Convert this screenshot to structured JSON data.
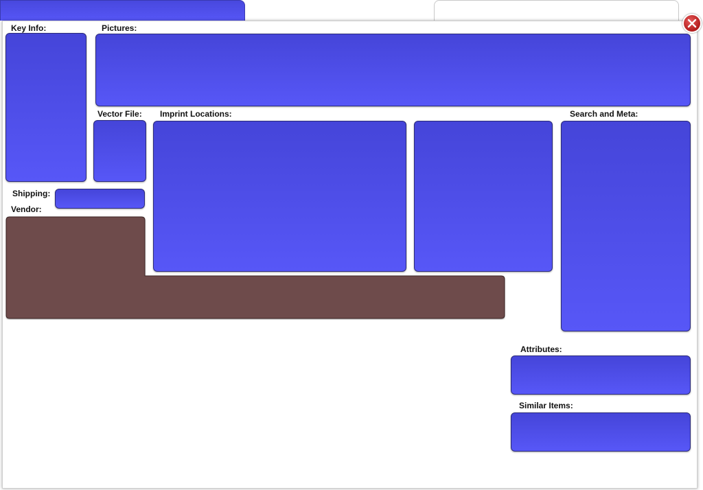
{
  "labels": {
    "key_info": "Key Info:",
    "pictures": "Pictures:",
    "vector_file": "Vector File:",
    "imprint_locations": "Imprint Locations:",
    "search_and_meta": "Search and Meta:",
    "shipping": "Shipping:",
    "vendor": "Vendor:",
    "attributes": "Attributes:",
    "similar_items": "Similar Items:"
  },
  "icons": {
    "close": "close-icon"
  },
  "colors": {
    "box_fill_top": "#4545d9",
    "box_fill_bottom": "#5757f7",
    "vendor_fill": "#6e4b4b",
    "close_red": "#b31c1c"
  }
}
